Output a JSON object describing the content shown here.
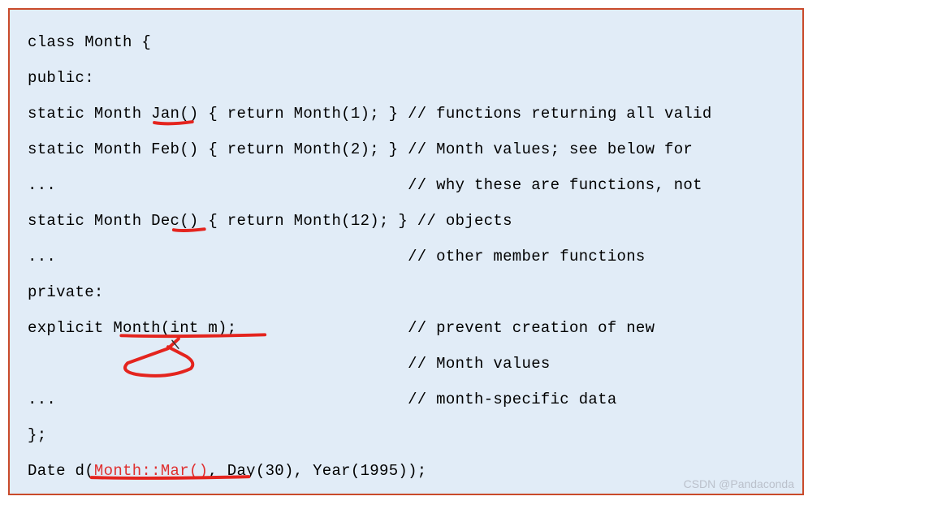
{
  "code": {
    "line1": "class Month {",
    "line2": "public:",
    "line3a": "static Month Jan() { return Month(1); } ",
    "line3b": "// functions returning all valid",
    "line4a": "static Month Feb() { return Month(2); } ",
    "line4b": "// Month values; see below for",
    "line5a": "...                                     ",
    "line5b": "// why these are functions, not",
    "line6a": "static Month Dec() { return Month(12); } ",
    "line6b": "// objects",
    "line7a": "...                                     ",
    "line7b": "// other member functions",
    "line8": "private:",
    "line9a": "explicit Month(int m);                  ",
    "line9b": "// prevent creation of new",
    "line10a": "                                        ",
    "line10b": "// Month values",
    "line11a": "...                                     ",
    "line11b": "// month-specific data",
    "line12": "};",
    "line13a": "Date d(",
    "line13b": "Month::Mar()",
    "line13c": ", Day(30), Year(1995));"
  },
  "watermark": "CSDN @Pandaconda",
  "annotations": [
    {
      "type": "underline",
      "name": "jan-underline"
    },
    {
      "type": "underline",
      "name": "dec-underline"
    },
    {
      "type": "underline-arrow",
      "name": "month-constructor-underline"
    },
    {
      "type": "underline",
      "name": "mar-underline"
    }
  ]
}
